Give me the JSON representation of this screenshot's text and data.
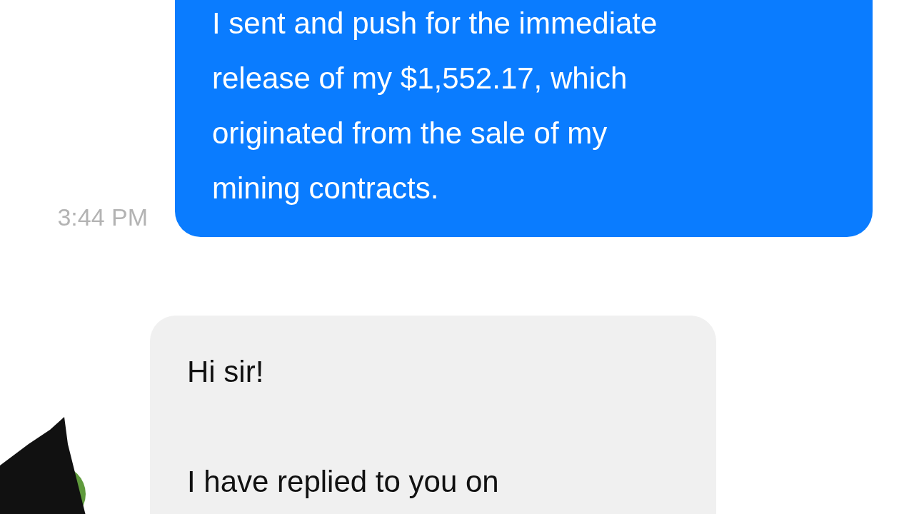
{
  "sent_message": {
    "time": "3:44 PM",
    "text": "I sent and push for the immediate\nrelease of my $1,552.17, which\noriginated from the sale of my\nmining contracts."
  },
  "received_message": {
    "paragraphs": [
      "Hi sir!",
      "I have replied to you on"
    ]
  }
}
